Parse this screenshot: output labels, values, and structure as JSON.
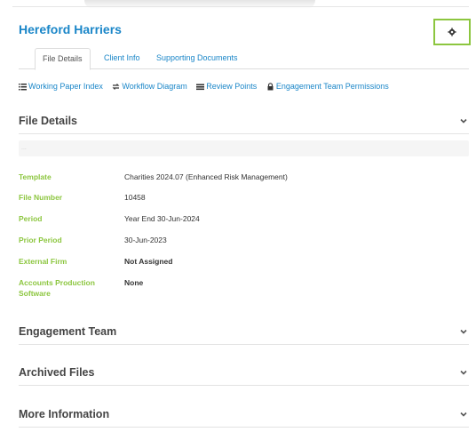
{
  "page": {
    "title": "Hereford Harriers"
  },
  "toolbar": {
    "settings_icon": "gear-icon"
  },
  "tabs": [
    {
      "label": "File Details",
      "active": true
    },
    {
      "label": "Client Info",
      "active": false
    },
    {
      "label": "Supporting Documents",
      "active": false
    }
  ],
  "links": [
    {
      "label": "Working Paper Index",
      "icon": "list-icon"
    },
    {
      "label": "Workflow Diagram",
      "icon": "workflow-icon"
    },
    {
      "label": "Review Points",
      "icon": "review-points-icon"
    },
    {
      "label": "Engagement Team Permissions",
      "icon": "lock-icon"
    }
  ],
  "file_details": {
    "heading": "File Details",
    "notice": "...",
    "rows": [
      {
        "label": "Template",
        "value": "Charities 2024.07 (Enhanced Risk Management)"
      },
      {
        "label": "File Number",
        "value": "10458"
      },
      {
        "label": "Period",
        "value": "Year End 30-Jun-2024"
      },
      {
        "label": "Prior Period",
        "value": "30-Jun-2023"
      },
      {
        "label": "External Firm",
        "value": "Not Assigned"
      },
      {
        "label": "Accounts Production Software",
        "value": "None"
      }
    ]
  },
  "sections": [
    {
      "heading": "Engagement Team"
    },
    {
      "heading": "Archived Files"
    },
    {
      "heading": "More Information"
    }
  ],
  "colors": {
    "accent_blue": "#1a86c8",
    "accent_green": "#8cc63f"
  }
}
